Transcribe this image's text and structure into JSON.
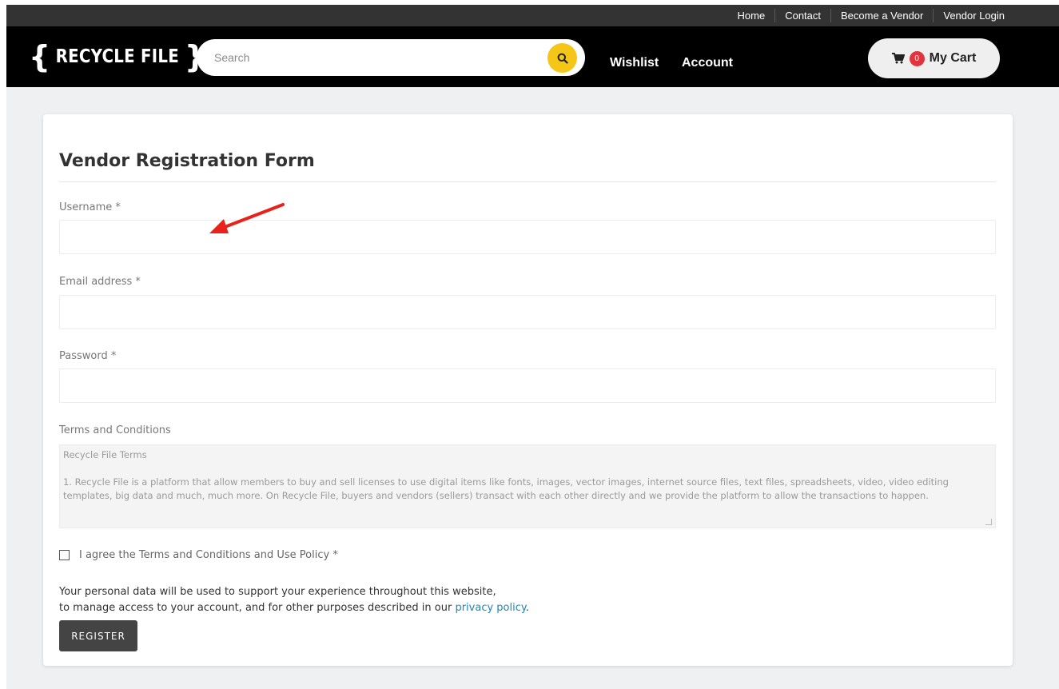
{
  "topnav": {
    "links": [
      "Home",
      "Contact",
      "Become a Vendor",
      "Vendor Login"
    ]
  },
  "header": {
    "logo_text": "RECYCLE FILE",
    "search_placeholder": "Search",
    "wishlist_label": "Wishlist",
    "account_label": "Account",
    "cart_count": "0",
    "cart_label": "My Cart",
    "search_button_color": "#f5c518",
    "badge_color": "#e2343c"
  },
  "form": {
    "title": "Vendor Registration Form",
    "username_label": "Username *",
    "email_label": "Email address *",
    "password_label": "Password *",
    "terms_label": "Terms and Conditions",
    "terms_heading": "Recycle File Terms",
    "terms_body": "1. Recycle File is a platform that allow members to buy and sell licenses to use digital items like fonts, images, vector images, internet source files, text files, spreadsheets, video, video editing templates, big data and much, much more. On Recycle File, buyers and vendors (sellers) transact with each other directly and we provide the platform to allow the transactions to happen.",
    "agree_label": "I agree the Terms and Conditions and Use Policy *",
    "privacy_line1": "Your personal data will be used to support your experience throughout this website,",
    "privacy_line2": "to manage access to your account, and for other purposes described in our",
    "privacy_link": "privacy policy",
    "privacy_end": ".",
    "register_label": "REGISTER"
  }
}
